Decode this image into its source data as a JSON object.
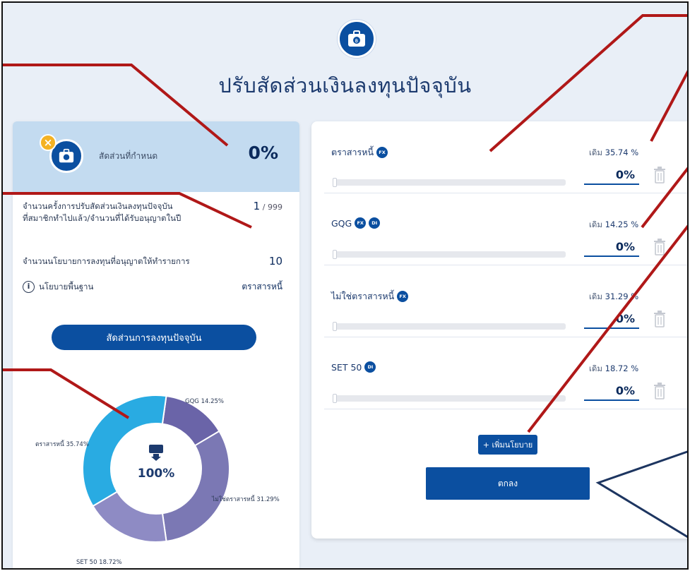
{
  "page": {
    "title": "ปรับสัดส่วนเงินลงทุนปัจจุบัน",
    "icon": "briefcase-coin-icon",
    "accent_color": "#0b4fa0"
  },
  "left_panel": {
    "ratio_label": "สัดส่วนที่กำหนด",
    "ratio_value": "0%",
    "adjust_count_label_line1": "จำนวนครั้งการปรับสัดส่วนเงินลงทุนปัจจุบัน",
    "adjust_count_label_line2": "ที่สมาชิกทำไปแล้ว/จำนวนที่ได้รับอนุญาตในปี",
    "adjust_count_used": "1",
    "adjust_count_max": "/ 999",
    "policy_count_label": "จำนวนนโยบายการลงทุนที่อนุญาตให้ทำรายการ",
    "policy_count_value": "10",
    "base_policy_label": "นโยบายพื้นฐาน",
    "base_policy_value": "ตราสารหนี้",
    "current_button_label": "สัดส่วนการลงทุนปัจจุบัน"
  },
  "chart_data": {
    "type": "pie",
    "title": "",
    "center_label": "100%",
    "categories": [
      "GQG",
      "ไม่ใช่ตราสารหนี้",
      "SET 50",
      "ตราสารหนี้"
    ],
    "values": [
      14.25,
      31.29,
      18.72,
      35.74
    ],
    "labels": [
      "GQG 14.25%",
      "ไม่ใช่ตราสารหนี้ 31.29%",
      "SET 50 18.72%",
      "ตราสารหนี้ 35.74%"
    ],
    "colors": [
      "#6a64a8",
      "#7b78b4",
      "#8e8bc4",
      "#29abe2"
    ]
  },
  "right_panel": {
    "policies": [
      {
        "name": "ตราสารหนี้",
        "tags": [
          "FX"
        ],
        "prev_label": "เดิม",
        "prev_value": "35.74 %",
        "input_value": "0%"
      },
      {
        "name": "GQG",
        "tags": [
          "FX",
          "DI"
        ],
        "prev_label": "เดิม",
        "prev_value": "14.25 %",
        "input_value": "0%"
      },
      {
        "name": "ไม่ใช่ตราสารหนี้",
        "tags": [
          "FX"
        ],
        "prev_label": "เดิม",
        "prev_value": "31.29 %",
        "input_value": "0%"
      },
      {
        "name": "SET 50",
        "tags": [
          "DI"
        ],
        "prev_label": "เดิม",
        "prev_value": "18.72 %",
        "input_value": "0%"
      }
    ],
    "add_button_label": "+ เพิ่มนโยบาย",
    "ok_button_label": "ตกลง"
  }
}
